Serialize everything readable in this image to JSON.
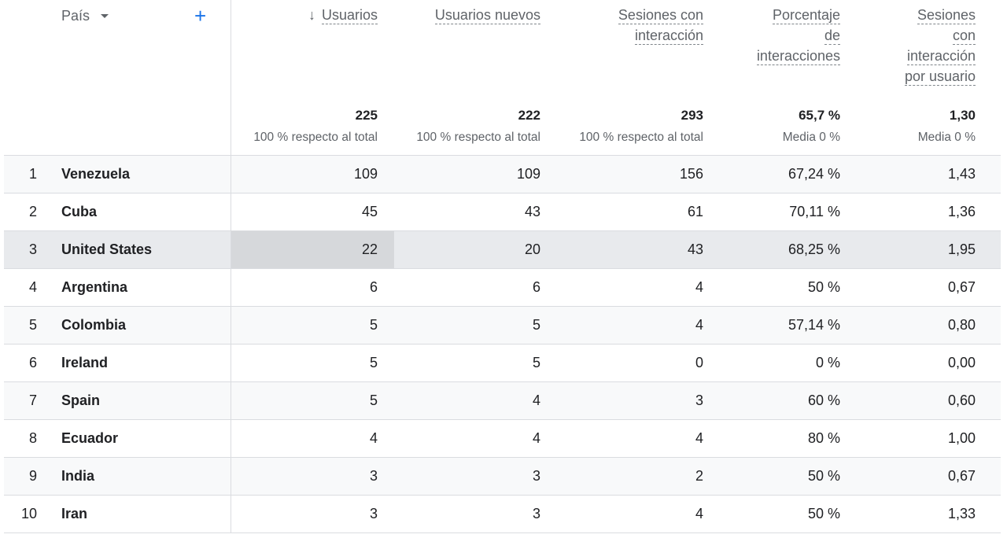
{
  "dimension": {
    "label": "País"
  },
  "columns": [
    {
      "label": "Usuarios",
      "lines": [
        "Usuarios"
      ],
      "total": "225",
      "sub": "100 % respecto al total",
      "sorted": true
    },
    {
      "label": "Usuarios nuevos",
      "lines": [
        "Usuarios nuevos"
      ],
      "total": "222",
      "sub": "100 % respecto al total"
    },
    {
      "label": "Sesiones con interacción",
      "lines": [
        "Sesiones con",
        "interacción"
      ],
      "total": "293",
      "sub": "100 % respecto al total"
    },
    {
      "label": "Porcentaje de interacciones",
      "lines": [
        "Porcentaje",
        "de",
        "interacciones"
      ],
      "total": "65,7 %",
      "sub": "Media 0 %"
    },
    {
      "label": "Sesiones con interacción por usuario",
      "lines": [
        "Sesiones",
        "con",
        "interacción",
        "por usuario"
      ],
      "total": "1,30",
      "sub": "Media 0 %"
    }
  ],
  "rows": [
    {
      "idx": "1",
      "country": "Venezuela",
      "v": [
        "109",
        "109",
        "156",
        "67,24 %",
        "1,43"
      ]
    },
    {
      "idx": "2",
      "country": "Cuba",
      "v": [
        "45",
        "43",
        "61",
        "70,11 %",
        "1,36"
      ]
    },
    {
      "idx": "3",
      "country": "United States",
      "v": [
        "22",
        "20",
        "43",
        "68,25 %",
        "1,95"
      ]
    },
    {
      "idx": "4",
      "country": "Argentina",
      "v": [
        "6",
        "6",
        "4",
        "50 %",
        "0,67"
      ]
    },
    {
      "idx": "5",
      "country": "Colombia",
      "v": [
        "5",
        "5",
        "4",
        "57,14 %",
        "0,80"
      ]
    },
    {
      "idx": "6",
      "country": "Ireland",
      "v": [
        "5",
        "5",
        "0",
        "0 %",
        "0,00"
      ]
    },
    {
      "idx": "7",
      "country": "Spain",
      "v": [
        "5",
        "4",
        "3",
        "60 %",
        "0,60"
      ]
    },
    {
      "idx": "8",
      "country": "Ecuador",
      "v": [
        "4",
        "4",
        "4",
        "80 %",
        "1,00"
      ]
    },
    {
      "idx": "9",
      "country": "India",
      "v": [
        "3",
        "3",
        "2",
        "50 %",
        "0,67"
      ]
    },
    {
      "idx": "10",
      "country": "Iran",
      "v": [
        "3",
        "3",
        "4",
        "50 %",
        "1,33"
      ]
    }
  ]
}
